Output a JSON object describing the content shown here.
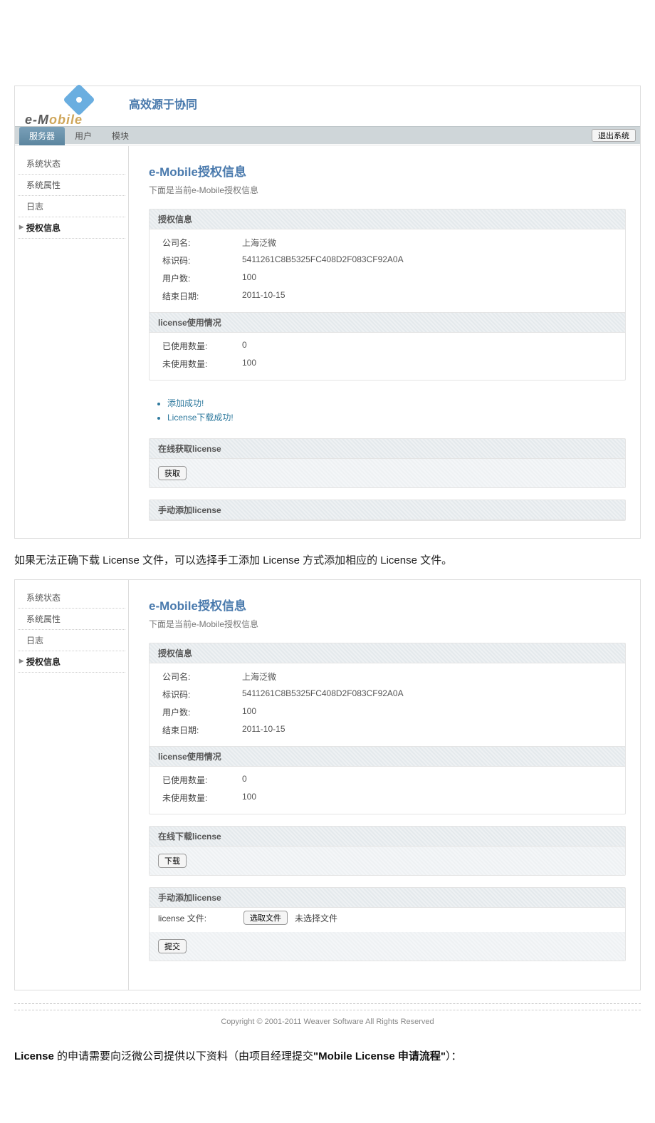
{
  "header": {
    "tagline": "高效源于协同",
    "logo_text_prefix": "e-M",
    "logo_text_suffix": "obile",
    "tabs": [
      "服务器",
      "用户",
      "模块"
    ],
    "logout": "退出系统"
  },
  "sidebar": {
    "items": [
      "系统状态",
      "系统属性",
      "日志",
      "授权信息"
    ]
  },
  "content": {
    "title": "e-Mobile授权信息",
    "subtitle": "下面是当前e-Mobile授权信息",
    "section1_head": "授权信息",
    "company_lab": "公司名:",
    "company_val": "上海泛微",
    "idcode_lab": "标识码:",
    "idcode_val": "5411261C8B5325FC408D2F083CF92A0A",
    "users_lab": "用户数:",
    "users_val": "100",
    "enddate_lab": "结束日期:",
    "enddate_val": "2011-10-15",
    "section2_head": "license使用情况",
    "used_lab": "已使用数量:",
    "used_val": "0",
    "unused_lab": "未使用数量:",
    "unused_val": "100",
    "msgs": [
      "添加成功!",
      "License下载成功!"
    ],
    "online_get_head": "在线获取license",
    "get_btn": "获取",
    "manual_head": "手动添加license",
    "online_dl_head": "在线下载license",
    "dl_btn": "下载",
    "file_lab": "license 文件:",
    "choose_btn": "选取文件",
    "no_file": "未选择文件",
    "submit_btn": "提交"
  },
  "doc": {
    "para1": "如果无法正确下载 License 文件，可以选择手工添加 License 方式添加相应的 License 文件。",
    "footer": "Copyright © 2001-2011 Weaver Software All Rights Reserved",
    "para2_prefix": "License",
    "para2_mid": " 的申请需要向泛微公司提供以下资料（由项目经理提交",
    "para2_q1": "\"Mobile License",
    "para2_q2": " 申请流程\"",
    "para2_suffix": "）："
  }
}
